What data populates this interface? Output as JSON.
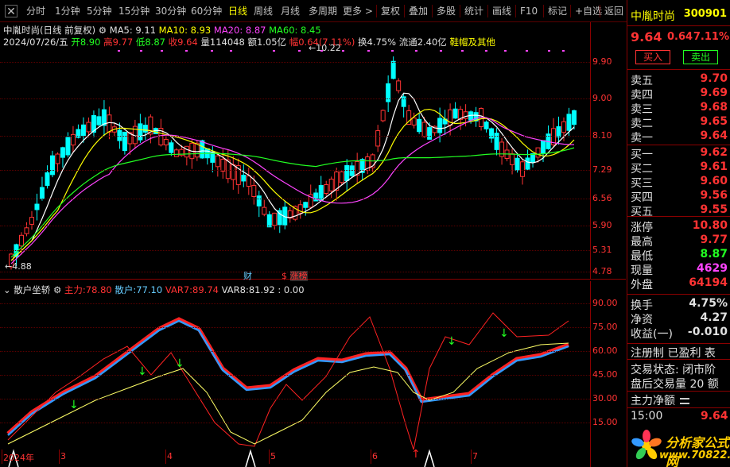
{
  "toolbar": {
    "items": [
      {
        "label": "分时",
        "active": false
      },
      {
        "label": "1分钟",
        "active": false
      },
      {
        "label": "5分钟",
        "active": false
      },
      {
        "label": "15分钟",
        "active": false
      },
      {
        "label": "30分钟",
        "active": false
      },
      {
        "label": "60分钟",
        "active": false
      },
      {
        "label": "日线",
        "active": true
      },
      {
        "label": "周线",
        "active": false
      },
      {
        "label": "月线",
        "active": false
      },
      {
        "label": "多周期",
        "active": false
      },
      {
        "label": "更多",
        "active": false
      }
    ],
    "right_items": [
      "复权",
      "叠加",
      "多股",
      "统计",
      "画线",
      "F10",
      "标记",
      "+自选",
      "返回"
    ]
  },
  "chart": {
    "title": "中胤时尚(日线 前复权)",
    "ma5": "MA5: 9.11",
    "ma10": "MA10: 8.93",
    "ma20": "MA20: 8.87",
    "ma60": "MA60: 8.45",
    "date": "2024/07/26/五",
    "open_lbl": "开",
    "open": "8.90",
    "high_lbl": "高",
    "high": "9.77",
    "low_lbl": "低",
    "low": "8.87",
    "close_lbl": "收",
    "close": "9.64",
    "vol_lbl": "量",
    "vol": "114048",
    "amt_lbl": "额",
    "amt": "1.05亿",
    "chg_lbl": "幅",
    "chg": "0.64(7.11%)",
    "turn": "换4.75%",
    "float": "流通2.40亿",
    "sector": "鞋帽及其他",
    "high_marker": "10.22",
    "low_marker": "4.88",
    "price_ticks": [
      "9.90",
      "9.00",
      "8.10",
      "7.29",
      "6.56",
      "5.90",
      "5.31",
      "4.78"
    ],
    "event_cai": "财",
    "event_zb": "涨榜",
    "event_dollar": "$"
  },
  "indicator": {
    "name": "散户坐轿",
    "main_label": "主力:",
    "main_val": "78.80",
    "retail_label": "散户:",
    "retail_val": "77.10",
    "var7_label": "VAR7:",
    "var7_val": "89.74",
    "var8_label": "VAR8:",
    "var8_val": "81.92 : 0.00",
    "ticks": [
      "90.00",
      "75.00",
      "60.00",
      "45.00",
      "30.00",
      "15.00"
    ],
    "x_labels": [
      "2024年",
      "3",
      "4",
      "5",
      "6",
      "7"
    ]
  },
  "quote": {
    "name": "中胤时尚",
    "code": "300901",
    "price": "9.64",
    "change": "0.64",
    "pct": "7.11%",
    "buy_btn": "买入",
    "sell_btn": "卖出",
    "asks": [
      {
        "label": "卖五",
        "price": "9.70"
      },
      {
        "label": "卖四",
        "price": "9.69"
      },
      {
        "label": "卖三",
        "price": "9.68"
      },
      {
        "label": "卖二",
        "price": "9.65"
      },
      {
        "label": "卖一",
        "price": "9.64"
      }
    ],
    "bids": [
      {
        "label": "买一",
        "price": "9.62"
      },
      {
        "label": "买二",
        "price": "9.61"
      },
      {
        "label": "买三",
        "price": "9.60"
      },
      {
        "label": "买四",
        "price": "9.56"
      },
      {
        "label": "买五",
        "price": "9.55"
      }
    ],
    "stats": [
      {
        "label": "涨停",
        "value": "10.80",
        "color": "#ff3333"
      },
      {
        "label": "最高",
        "value": "9.77",
        "color": "#ff3333"
      },
      {
        "label": "最低",
        "value": "8.87",
        "color": "#22ff22"
      },
      {
        "label": "现量",
        "value": "4629",
        "color": "#ff44ff"
      },
      {
        "label": "外盘",
        "value": "64194",
        "color": "#ff3333"
      }
    ],
    "stats2": [
      {
        "label": "换手",
        "value": "4.75%",
        "color": "#e0e0e0"
      },
      {
        "label": "净资",
        "value": "4.27",
        "color": "#e0e0e0"
      },
      {
        "label": "收益(一)",
        "value": "-0.010",
        "color": "#e0e0e0"
      }
    ],
    "reg": "注册制 已盈利 表",
    "trade_state": "交易状态: 闭市阶",
    "after_vol": "盘后交易量 20 额",
    "main_net": "主力净额",
    "time": "15:00",
    "time_price": "9.64",
    "logo_name": "分析家公式网",
    "logo_url": "www.70822.com"
  },
  "colors": {
    "up": "#ff3333",
    "down": "#00ffff",
    "ma5": "#ffffff",
    "ma10": "#ffff00",
    "ma20": "#ff44ff",
    "ma60": "#22ff22"
  }
}
